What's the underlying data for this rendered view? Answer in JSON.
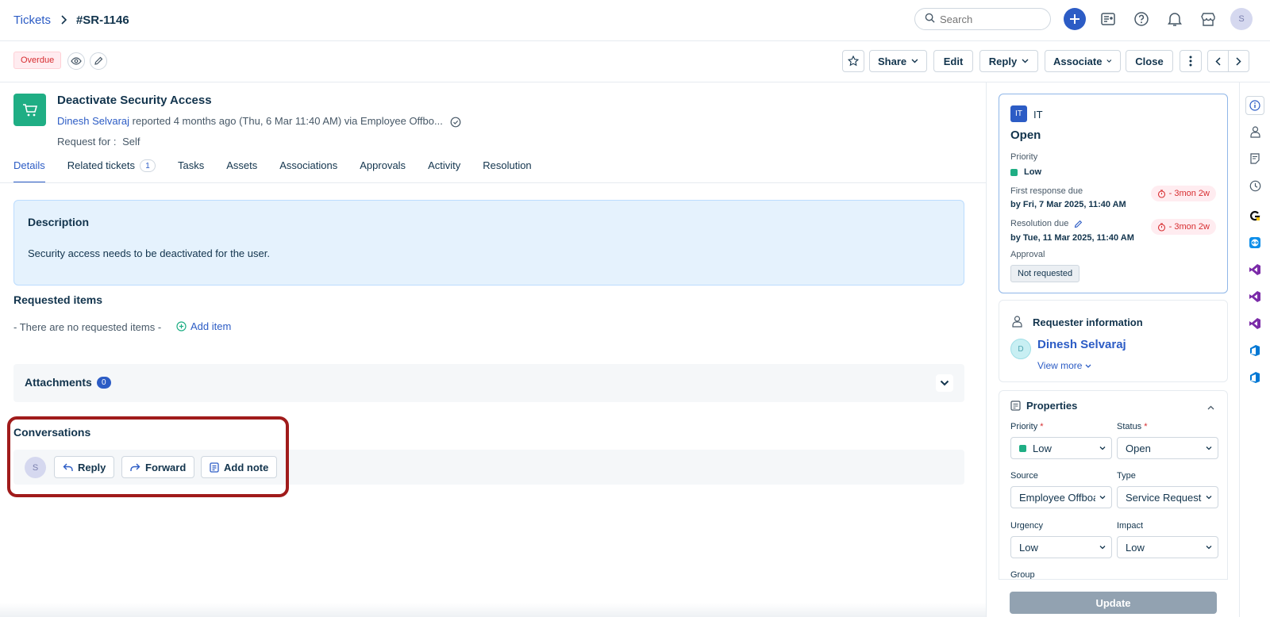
{
  "breadcrumb": {
    "root": "Tickets",
    "id": "#SR-1146"
  },
  "search": {
    "placeholder": "Search"
  },
  "top_icons": [
    "plus-icon",
    "agent-directory-icon",
    "help-icon",
    "bell-icon",
    "apps-store-icon"
  ],
  "user": {
    "initial": "S"
  },
  "action_bar": {
    "overdue": "Overdue",
    "share": "Share",
    "edit": "Edit",
    "reply": "Reply",
    "associate": "Associate",
    "close": "Close"
  },
  "ticket": {
    "title": "Deactivate Security Access",
    "requester": "Dinesh Selvaraj",
    "meta": "reported 4 months ago (Thu, 6 Mar 11:40 AM) via Employee Offbo...",
    "request_for_label": "Request for :",
    "request_for_value": "Self"
  },
  "tabs": [
    {
      "label": "Details",
      "active": true
    },
    {
      "label": "Related tickets",
      "count": "1"
    },
    {
      "label": "Tasks"
    },
    {
      "label": "Assets"
    },
    {
      "label": "Associations"
    },
    {
      "label": "Approvals"
    },
    {
      "label": "Activity"
    },
    {
      "label": "Resolution"
    }
  ],
  "description": {
    "heading": "Description",
    "text": "Security access needs to be deactivated for the user."
  },
  "requested_items": {
    "heading": "Requested items",
    "empty": "- There are no requested items -",
    "add": "Add item"
  },
  "attachments": {
    "heading": "Attachments",
    "count": "0"
  },
  "conversations": {
    "heading": "Conversations",
    "avatar": "S",
    "reply": "Reply",
    "forward": "Forward",
    "add_note": "Add note"
  },
  "sla": {
    "group_badge": "IT",
    "group": "IT",
    "status": "Open",
    "priority_label": "Priority",
    "priority": "Low",
    "first_response_label": "First response due",
    "first_response": "by Fri, 7 Mar 2025, 11:40 AM",
    "first_response_late": "- 3mon 2w",
    "resolution_label": "Resolution due",
    "resolution": "by Tue, 11 Mar 2025, 11:40 AM",
    "resolution_late": "- 3mon 2w",
    "approval_label": "Approval",
    "approval": "Not requested"
  },
  "requester_info": {
    "heading": "Requester information",
    "avatar": "D",
    "name": "Dinesh Selvaraj",
    "view_more": "View more"
  },
  "properties": {
    "heading": "Properties",
    "priority_label": "Priority",
    "priority": "Low",
    "status_label": "Status",
    "status": "Open",
    "source_label": "Source",
    "source": "Employee Offboarding",
    "type_label": "Type",
    "type": "Service Request",
    "urgency_label": "Urgency",
    "urgency": "Low",
    "impact_label": "Impact",
    "impact": "Low",
    "group_label": "Group",
    "required_mark": "*",
    "update": "Update"
  },
  "colors": {
    "accent": "#2c5cc5",
    "success": "#1fae84",
    "danger": "#d72d30",
    "highlight": "#a01b1b"
  }
}
